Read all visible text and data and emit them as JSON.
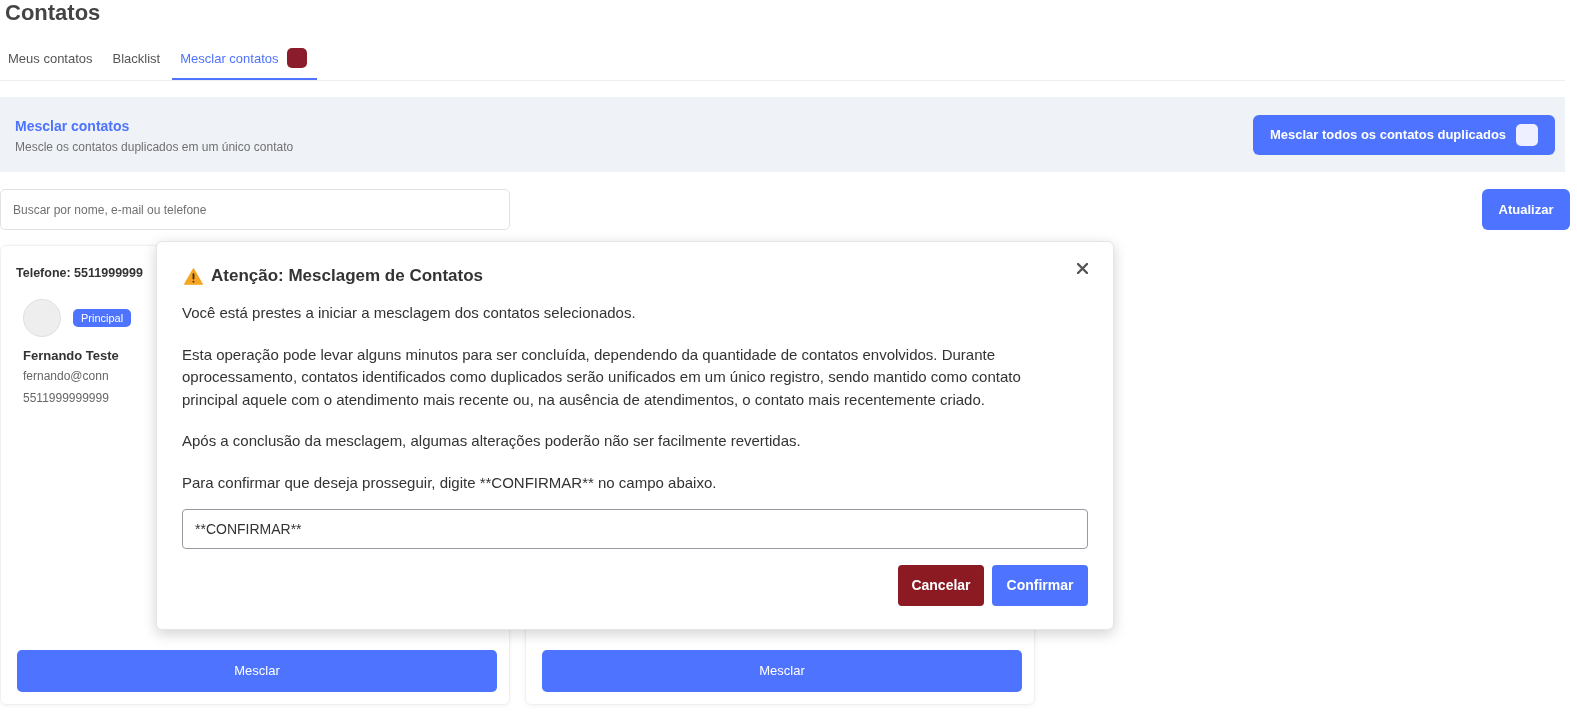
{
  "page_title": "Contatos",
  "tabs": [
    {
      "label": "Meus contatos",
      "selected": false,
      "has_badge": false
    },
    {
      "label": "Blacklist",
      "selected": false,
      "has_badge": false
    },
    {
      "label": "Mesclar contatos",
      "selected": true,
      "has_badge": true
    }
  ],
  "merge_banner": {
    "title": "Mesclar contatos",
    "subtitle": "Mescle os contatos duplicados em um único contato",
    "merge_all_button": "Mesclar todos os contatos duplicados"
  },
  "search": {
    "placeholder": "Buscar por nome, e-mail ou telefone"
  },
  "refresh_button": "Atualizar",
  "groups": [
    {
      "header": "Telefone: 5511999999",
      "contact": {
        "tag": "Principal",
        "name": "Fernando Teste",
        "email": "fernando@conn",
        "phone": "5511999999999"
      },
      "merge_button": "Mesclar"
    },
    {
      "merge_button": "Mesclar"
    }
  ],
  "dialog": {
    "title": "Atenção: Mesclagem de Contatos",
    "paragraphs": [
      "Você está prestes a iniciar a mesclagem dos contatos selecionados.",
      "Esta operação pode levar alguns minutos para ser concluída, dependendo da quantidade de contatos envolvidos. Durante oprocessamento, contatos identificados como duplicados serão unificados em um único registro, sendo mantido como contato principal aquele com o atendimento mais recente ou, na ausência de atendimentos, o contato mais recentemente criado.",
      "Após a conclusão da mesclagem, algumas alterações poderão não ser facilmente revertidas.",
      "Para confirmar que deseja prosseguir, digite **CONFIRMAR** no campo abaixo."
    ],
    "confirm_field": {
      "value": "**CONFIRMAR**"
    },
    "buttons": [
      {
        "label": "Cancelar",
        "kind": "cancel"
      },
      {
        "label": "Confirmar",
        "kind": "confirm"
      }
    ]
  }
}
